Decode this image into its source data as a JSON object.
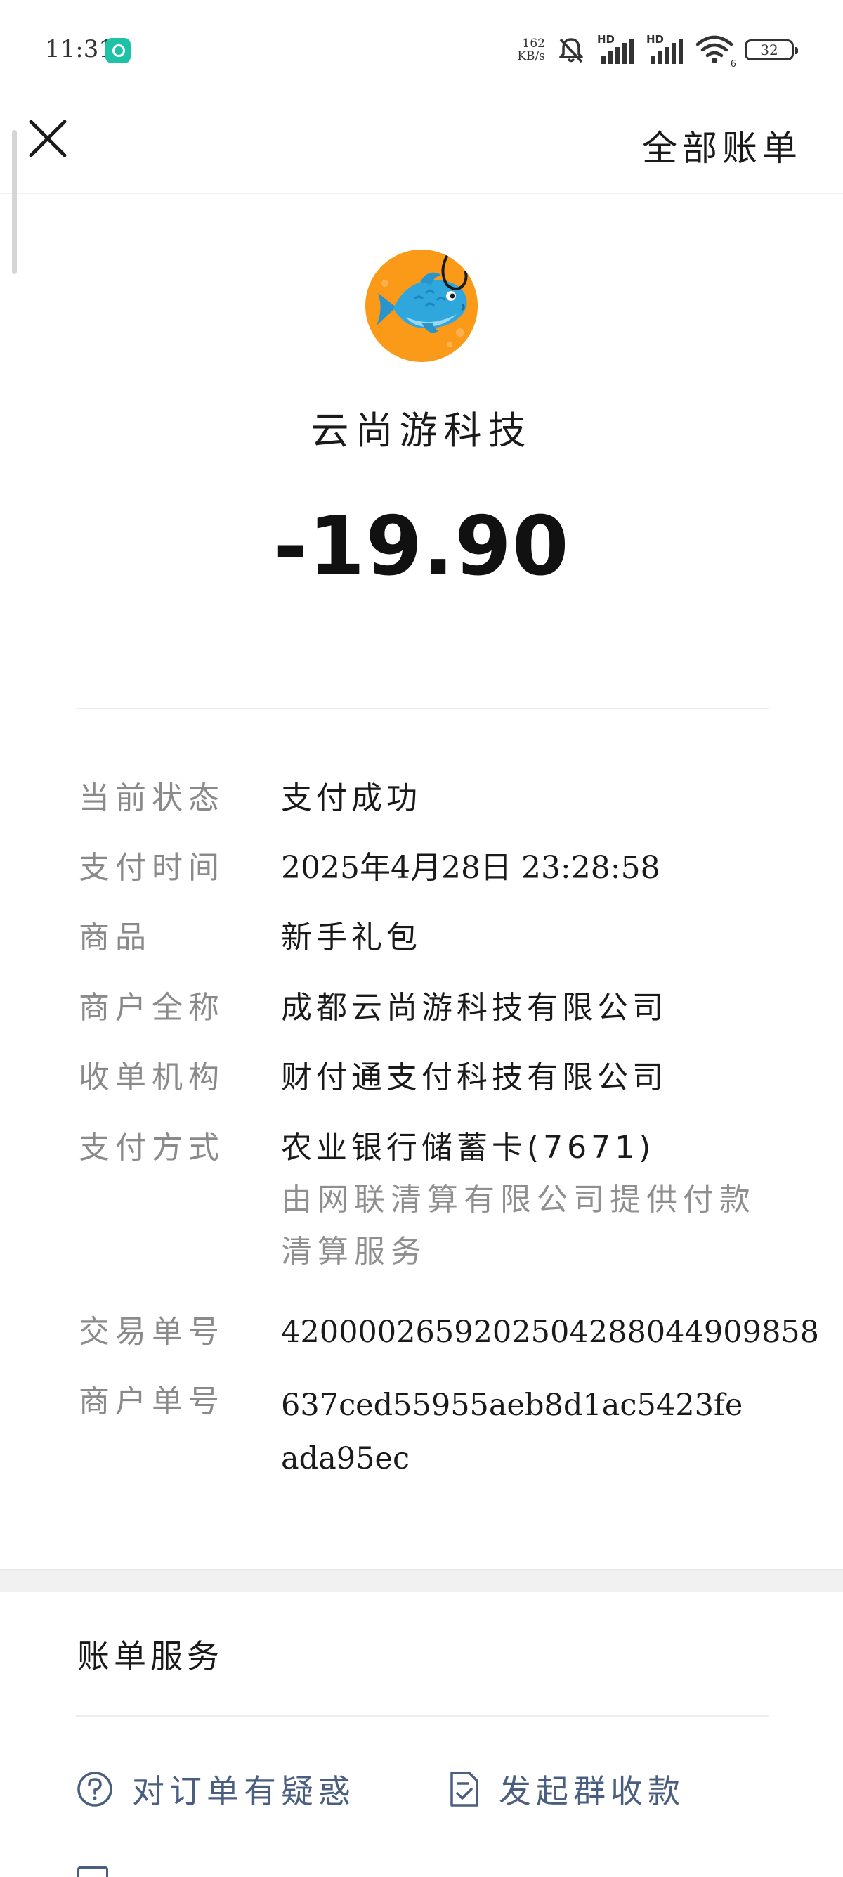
{
  "status_bar": {
    "time": "11:31",
    "net_speed_value": "162",
    "net_speed_unit": "KB/s",
    "signal_1_label": "HD",
    "signal_2_label": "HD",
    "wifi_badge": "6",
    "battery": "32"
  },
  "nav": {
    "all_bills_label": "全部账单"
  },
  "header": {
    "merchant_name": "云尚游科技",
    "amount": "-19.90"
  },
  "details": {
    "status_label": "当前状态",
    "status_value": "支付成功",
    "time_label": "支付时间",
    "time_value": "2025年4月28日 23:28:58",
    "product_label": "商品",
    "product_value": "新手礼包",
    "merchant_full_label": "商户全称",
    "merchant_full_value": "成都云尚游科技有限公司",
    "acquirer_label": "收单机构",
    "acquirer_value": "财付通支付科技有限公司",
    "method_label": "支付方式",
    "method_value": "农业银行储蓄卡(7671)",
    "method_note": "由网联清算有限公司提供付款清算服务",
    "transaction_no_label": "交易单号",
    "transaction_no_value": "4200002659202504288044909858",
    "merchant_no_label": "商户单号",
    "merchant_no_value": "637ced55955aeb8d1ac5423feada95ec"
  },
  "service": {
    "title": "账单服务",
    "question_label": "对订单有疑惑",
    "group_collect_label": "发起群收款"
  },
  "colors": {
    "service_link": "#4a5f7f",
    "label_gray": "#8a8a8a",
    "avatar_orange": "#fa9a18",
    "fish_blue": "#2fa7dd"
  },
  "icons": {
    "close": "close-icon",
    "question": "question-circle-icon",
    "document": "document-check-icon",
    "app": "wechat-pay-app-icon"
  }
}
